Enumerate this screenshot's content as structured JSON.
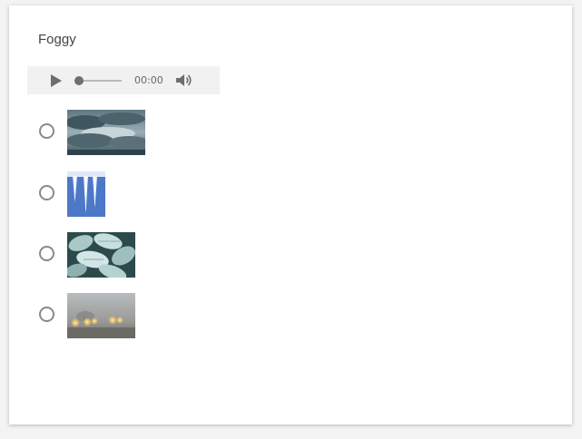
{
  "question": {
    "title": "Foggy"
  },
  "audio": {
    "time": "00:00",
    "progress": 0,
    "icons": {
      "play": "play-icon",
      "volume": "volume-icon"
    }
  },
  "options": [
    {
      "id": "option-1",
      "image": "storm-clouds-image",
      "selected": false
    },
    {
      "id": "option-2",
      "image": "icicles-image",
      "selected": false
    },
    {
      "id": "option-3",
      "image": "frosted-leaves-image",
      "selected": false
    },
    {
      "id": "option-4",
      "image": "foggy-road-image",
      "selected": false
    }
  ],
  "colors": {
    "radio_border": "#8a8a8a",
    "player_bg": "#f1f1f1",
    "text": "#444444"
  }
}
